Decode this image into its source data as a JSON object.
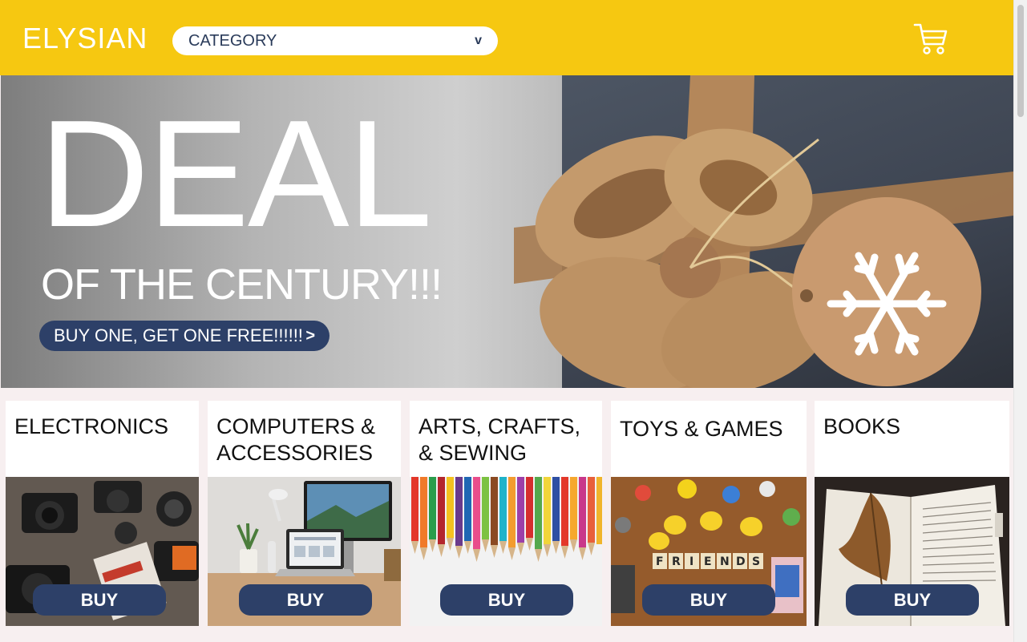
{
  "header": {
    "logo": "ELYSIAN",
    "category_select": {
      "value": "CATEGORY",
      "chevron": "v"
    },
    "cart_icon": "shopping-cart-icon"
  },
  "hero": {
    "headline": "DEAL",
    "subheadline": "OF THE CENTURY!!!",
    "cta_label": "BUY ONE, GET ONE FREE!!!!!!",
    "cta_arrow": ">"
  },
  "categories": [
    {
      "title": "ELECTRONICS",
      "buy_label": "BUY"
    },
    {
      "title": "COMPUTERS & ACCESSORIES",
      "buy_label": "BUY"
    },
    {
      "title": "ARTS, CRAFTS, & SEWING",
      "buy_label": "BUY"
    },
    {
      "title": "TOYS & GAMES",
      "buy_label": "BUY"
    },
    {
      "title": "BOOKS",
      "buy_label": "BUY"
    }
  ],
  "colors": {
    "header_bg": "#f6c811",
    "accent_navy": "#2d4068",
    "page_bg": "#f7eff0"
  }
}
